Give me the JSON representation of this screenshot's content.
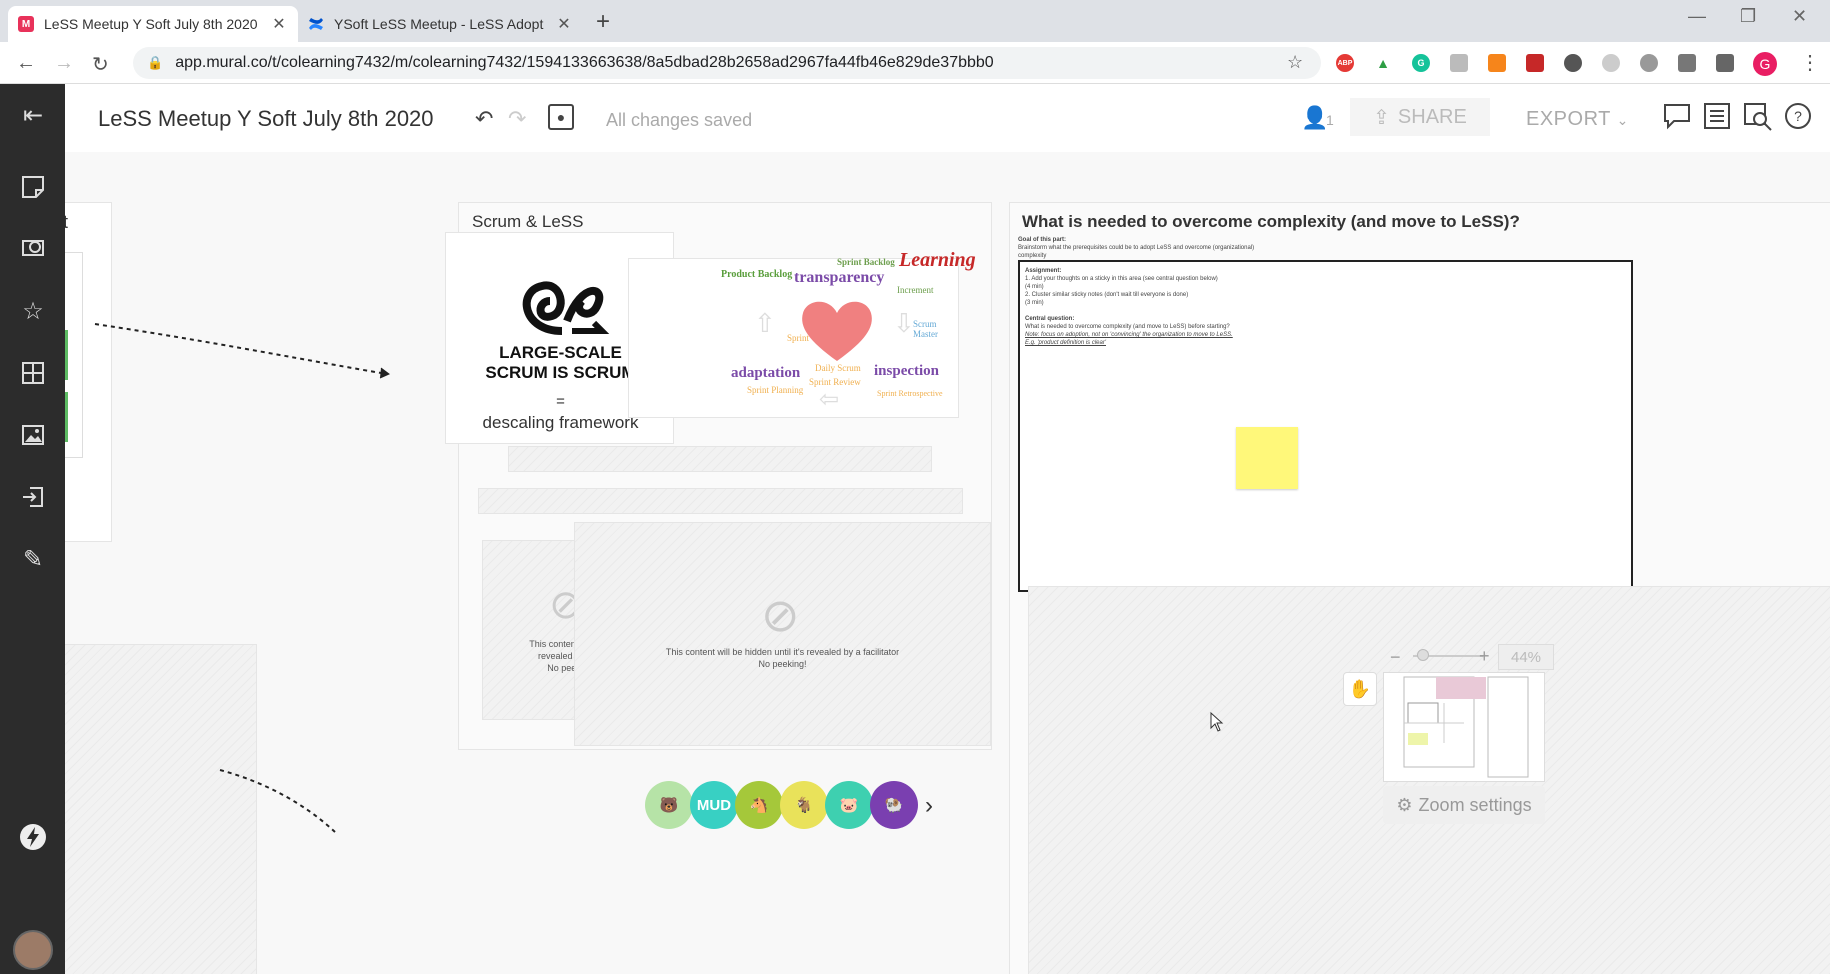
{
  "browser": {
    "tabs": [
      {
        "label": "LeSS Meetup Y Soft July 8th 2020",
        "favicon": "M"
      },
      {
        "label": "YSoft LeSS Meetup - LeSS Adopt",
        "favicon": ""
      }
    ],
    "url": "app.mural.co/t/colearning7432/m/colearning7432/1594133663638/8a5dbad28b2658ad2967fa44fb46e829de37bbb0",
    "profile_initial": "G",
    "ext_abp": "ABP"
  },
  "header": {
    "title": "LeSS Meetup Y Soft July 8th 2020",
    "saved_status": "All changes saved",
    "user_count": "1",
    "share_label": "SHARE",
    "export_label": "EXPORT"
  },
  "canvas": {
    "left_area_title": "t",
    "scrum_area_title": "Scrum & LeSS",
    "less_logo_line1": "LARGE-SCALE",
    "less_logo_line2": "SCRUM IS SCRUM",
    "equals": "=",
    "descaling": "descaling framework",
    "scrum_words": {
      "learning": "Learning",
      "transparency": "transparency",
      "product_backlog": "Product Backlog",
      "sprint_backlog": "Sprint Backlog",
      "increment": "Increment",
      "scrum_master": "Scrum Master",
      "sprint": "Sprint",
      "adaptation": "adaptation",
      "inspection": "inspection",
      "daily_scrum": "Daily Scrum",
      "sprint_review": "Sprint Review",
      "sprint_planning": "Sprint Planning",
      "sprint_retrospective": "Sprint Retrospective"
    },
    "complexity_title": "What is needed to overcome complexity (and move to LeSS)?",
    "goal_heading": "Goal of this part:",
    "goal_text": "Brainstorm what the prerequisites could be to adopt LeSS and overcome (organizational) complexity",
    "assignment_heading": "Assignment:",
    "assignment_1": "1. Add your thoughts on a sticky in this area (see central question below)",
    "assignment_1_time": "(4 min)",
    "assignment_2": "2. Cluster similar sticky notes (don't wait till everyone is done)",
    "assignment_2_time": "(3 min)",
    "central_heading": "Central question:",
    "central_text": "What is needed to overcome complexity (and move to LeSS) before starting?",
    "central_note": "Note: focus on adoption, not on 'convincing' the organization to move to LeSS. E.g. 'product definition is clear'",
    "hidden_text_1": "This content will be hidden until it's revealed by a facilitator",
    "hidden_text_2": "No peeking!",
    "hidden_partial_1": "This content will b",
    "hidden_partial_2": "revealed by a",
    "hidden_partial_3": "No peeki"
  },
  "zoom": {
    "minus": "−",
    "plus": "+",
    "percent": "44%",
    "settings_label": "Zoom settings"
  },
  "collaborators": [
    {
      "name": "bear",
      "label": "",
      "color": "#b6e3a7"
    },
    {
      "name": "mud",
      "label": "MUD",
      "color": "#38d0c3"
    },
    {
      "name": "horse",
      "label": "",
      "color": "#a5c83a"
    },
    {
      "name": "goat",
      "label": "",
      "color": "#e9e25a"
    },
    {
      "name": "pig",
      "label": "",
      "color": "#3ed0b0"
    },
    {
      "name": "ram",
      "label": "",
      "color": "#7a3fb0"
    }
  ],
  "colors": {
    "sidebar": "#2c2c2c",
    "sticky": "#fff87a",
    "green": "#5dbb63",
    "heart": "#f08080"
  }
}
